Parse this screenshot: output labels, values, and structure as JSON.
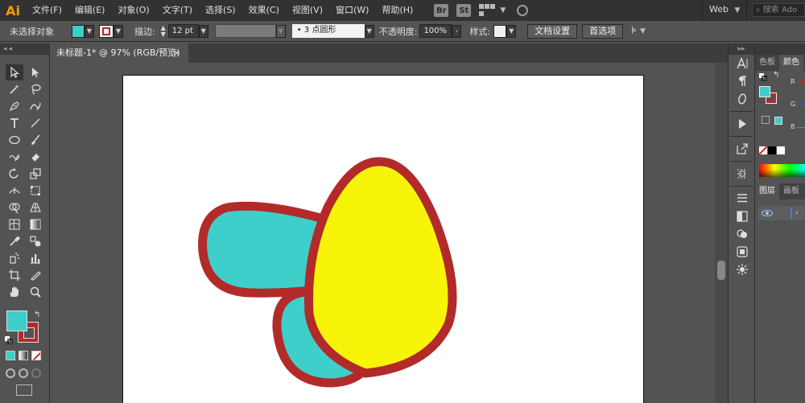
{
  "app": {
    "logo": "Ai",
    "menus": [
      "文件(F)",
      "编辑(E)",
      "对象(O)",
      "文字(T)",
      "选择(S)",
      "效果(C)",
      "视图(V)",
      "窗口(W)",
      "帮助(H)"
    ],
    "bridge_label": "Br",
    "stock_label": "St",
    "workspace": "Web",
    "search_placeholder": "搜索 Ado"
  },
  "control_bar": {
    "selection_status": "未选择对象",
    "stroke_label": "描边:",
    "stroke_weight": "12 pt",
    "brush_label": "•  3 点圆形",
    "opacity_label": "不透明度:",
    "opacity_value": "100%",
    "style_label": "样式:",
    "doc_setup_button": "文档设置",
    "preferences_button": "首选项"
  },
  "document": {
    "tab_title": "未标题-1* @ 97% (RGB/预览)",
    "close_glyph": "×"
  },
  "colors": {
    "fill": "#3ecfcb",
    "stroke": "#b22a2a",
    "petal_yellow": "#f7f409"
  },
  "color_panel": {
    "tabs": [
      "色板",
      "颜色"
    ],
    "channels": [
      "R",
      "G",
      "B"
    ]
  },
  "layers_panel": {
    "tabs": [
      "图层",
      "画板"
    ]
  },
  "tools": [
    "selection-tool",
    "direct-selection-tool",
    "magic-wand-tool",
    "lasso-tool",
    "pen-tool",
    "curvature-tool",
    "type-tool",
    "line-tool",
    "ellipse-tool",
    "paintbrush-tool",
    "shaper-tool",
    "eraser-tool",
    "rotate-tool",
    "scale-tool",
    "width-tool",
    "free-transform-tool",
    "shape-builder-tool",
    "perspective-grid-tool",
    "mesh-tool",
    "gradient-tool",
    "eyedropper-tool",
    "blend-tool",
    "symbol-sprayer-tool",
    "column-graph-tool",
    "artboard-tool",
    "slice-tool",
    "hand-tool",
    "zoom-tool"
  ]
}
